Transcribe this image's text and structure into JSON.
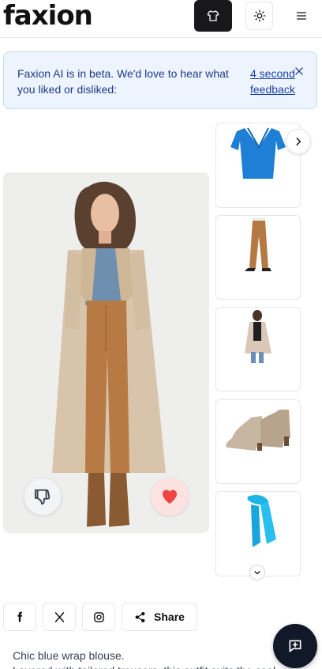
{
  "header": {
    "logo": "faxion",
    "icons": {
      "outfit": "shirt-icon",
      "theme": "sun-icon",
      "menu": "hamburger-menu-icon"
    }
  },
  "banner": {
    "text": "Faxion AI is in beta. We'd love to hear what you liked or disliked:",
    "link": "4 second feedback",
    "close_icon": "close-icon"
  },
  "outfit": {
    "main_image": "woman in trench coat, denim shirt and brown trousers",
    "dislike_icon": "thumbs-down-icon",
    "like_icon": "heart-icon",
    "thumbnails": [
      {
        "item": "blue wrap blouse"
      },
      {
        "item": "brown tailored trousers"
      },
      {
        "item": "beige trench coat outfit"
      },
      {
        "item": "beige ankle boots"
      },
      {
        "item": "blue scarf"
      }
    ]
  },
  "share": {
    "label": "Share",
    "icons": [
      "facebook-icon",
      "x-icon",
      "instagram-icon",
      "share-icon"
    ]
  },
  "description": {
    "line1": "Chic blue wrap blouse.",
    "line2": "Layered with tailored trousers, this outfit suits the cool"
  },
  "colors": {
    "accent_dark": "#18181b",
    "banner_bg": "#eef4fe",
    "banner_text": "#1e3a8a",
    "like_red": "#ef4444"
  }
}
